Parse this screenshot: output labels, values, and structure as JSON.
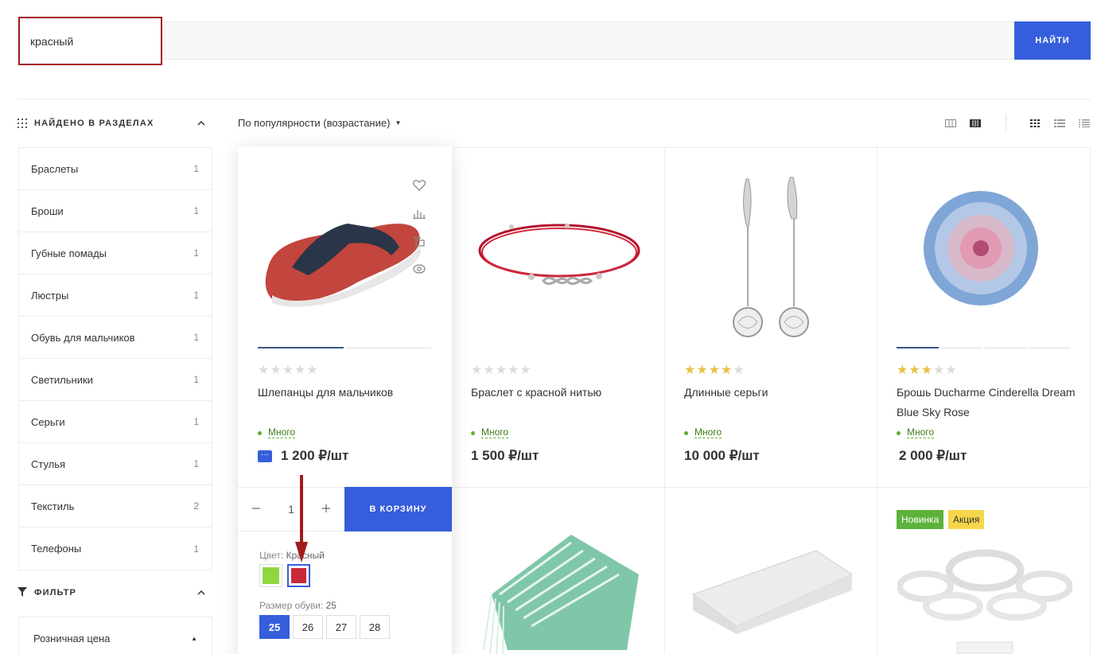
{
  "search": {
    "value": "красный",
    "button": "НАЙТИ"
  },
  "sidebar": {
    "sections_title": "НАЙДЕНО В РАЗДЕЛАХ",
    "categories": [
      {
        "label": "Браслеты",
        "count": "1"
      },
      {
        "label": "Броши",
        "count": "1"
      },
      {
        "label": "Губные помады",
        "count": "1"
      },
      {
        "label": "Люстры",
        "count": "1"
      },
      {
        "label": "Обувь для мальчиков",
        "count": "1"
      },
      {
        "label": "Светильники",
        "count": "1"
      },
      {
        "label": "Серьги",
        "count": "1"
      },
      {
        "label": "Стулья",
        "count": "1"
      },
      {
        "label": "Текстиль",
        "count": "2"
      },
      {
        "label": "Телефоны",
        "count": "1"
      }
    ],
    "filter_title": "ФИЛЬТР",
    "price_filter": "Розничная цена"
  },
  "toolbar": {
    "sort": "По популярности (возрастание)"
  },
  "products": [
    {
      "name": "Шлепанцы для мальчиков",
      "rating": 0,
      "stock": "Много",
      "price": "1 200 ₽/шт"
    },
    {
      "name": "Браслет с красной нитью",
      "rating": 0,
      "stock": "Много",
      "price": "1 500 ₽/шт"
    },
    {
      "name": "Длинные серьги",
      "rating": 4,
      "stock": "Много",
      "price": "10 000 ₽/шт"
    },
    {
      "name": "Брошь Ducharme Cinderella Dream Blue Sky Rose",
      "rating": 3,
      "stock": "Много",
      "price": "2 000 ₽/шт"
    }
  ],
  "active_card": {
    "qty": "1",
    "cart_button": "В КОРЗИНУ",
    "color_label": "Цвет:",
    "color_value": "Красный",
    "colors": [
      "#8fd63f",
      "#c8283a"
    ],
    "size_label": "Размер обуви:",
    "size_value": "25",
    "sizes": [
      "25",
      "26",
      "27",
      "28"
    ]
  },
  "badges": {
    "new": "Новинка",
    "sale": "Акция"
  },
  "colors": {
    "accent": "#365edc",
    "star": "#e8c04a",
    "stock": "#5fae2c",
    "annotation": "#a31c1c"
  }
}
